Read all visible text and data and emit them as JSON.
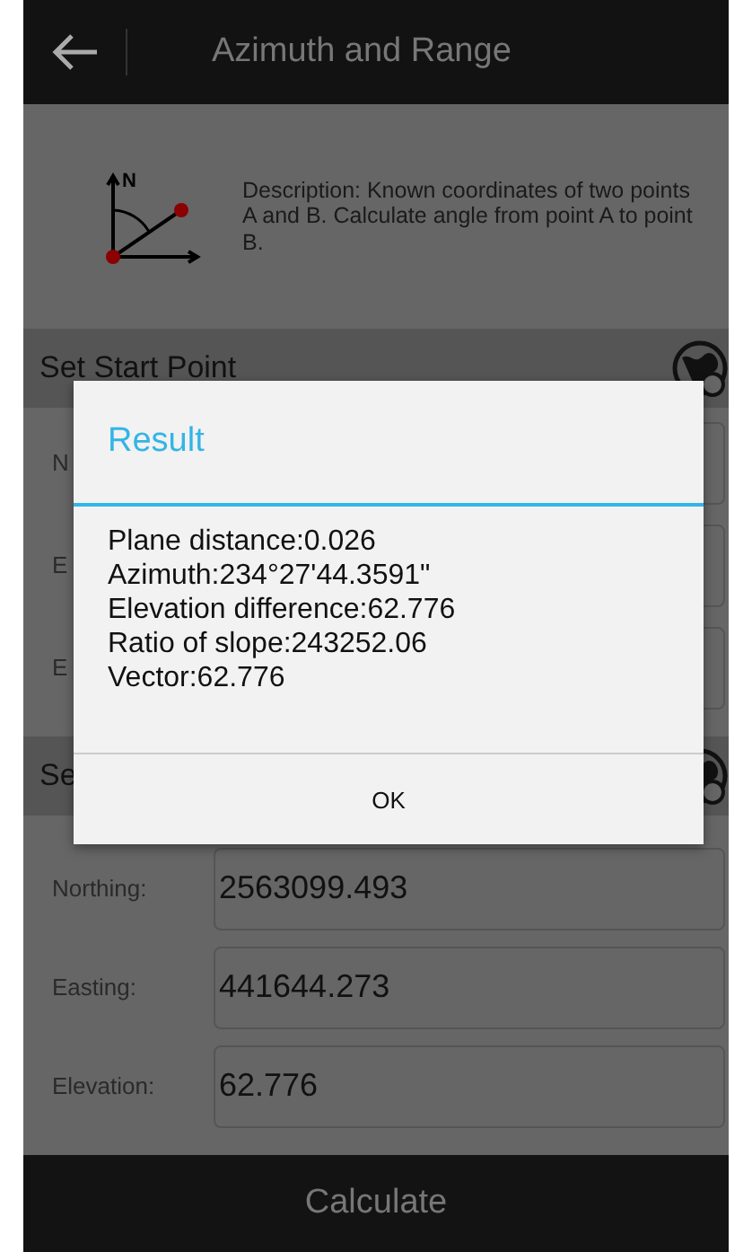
{
  "top_bar": {
    "title": "Azimuth and Range"
  },
  "diagram_label": "N",
  "description": "Description: Known coordinates of two points A and B. Calculate angle from point A to point B.",
  "sections": [
    {
      "title": "Set Start Point",
      "fields": [
        {
          "label": "N"
        },
        {
          "label": "E"
        },
        {
          "label": "E"
        }
      ]
    },
    {
      "title": "Se",
      "fields": [
        {
          "label": "Northing:",
          "value": "2563099.493"
        },
        {
          "label": "Easting:",
          "value": "441644.273"
        },
        {
          "label": "Elevation:",
          "value": "62.776"
        }
      ]
    }
  ],
  "calculate_button": "Calculate",
  "dialog": {
    "title": "Result",
    "lines": [
      "Plane distance:0.026",
      "Azimuth:234°27'44.3591\"",
      "Elevation difference:62.776",
      "Ratio of slope:243252.06",
      "Vector:62.776"
    ],
    "button": "OK"
  }
}
